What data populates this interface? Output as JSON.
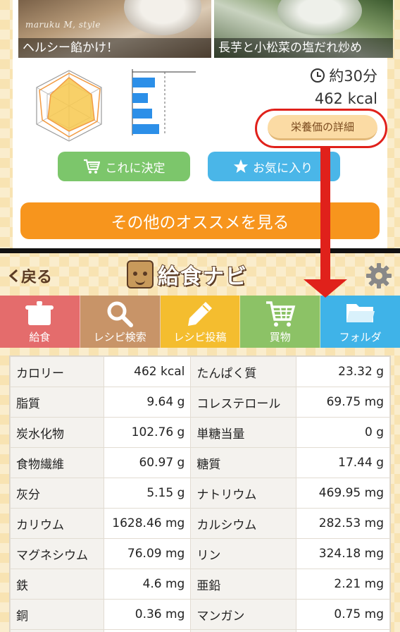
{
  "recipes": [
    {
      "name": "ヘルシー餡かけ！",
      "credit": "maruku M, style"
    },
    {
      "name": "長芋と小松菜の塩だれ炒め"
    }
  ],
  "summary": {
    "time": "約30分",
    "calories": "462 kcal"
  },
  "buttons": {
    "nutrition_detail": "栄養価の詳細",
    "decide": "これに決定",
    "favorite": "お気に入り",
    "more": "その他のオススメを見る"
  },
  "header": {
    "back": "戻る",
    "logo": "給食ナビ"
  },
  "tabs": [
    {
      "label": "給食",
      "color": "#e46c6c",
      "icon": "pot-icon"
    },
    {
      "label": "レシピ検索",
      "color": "#c89468",
      "icon": "magnifier-icon"
    },
    {
      "label": "レシピ投稿",
      "color": "#f4bd2f",
      "icon": "pencil-icon"
    },
    {
      "label": "買物",
      "color": "#8cc266",
      "icon": "cart-icon"
    },
    {
      "label": "フォルダ",
      "color": "#3fb3e8",
      "icon": "folder-icon"
    }
  ],
  "nutrition": [
    [
      "カロリー",
      "462 kcal",
      "たんぱく質",
      "23.32 g"
    ],
    [
      "脂質",
      "9.64 g",
      "コレステロール",
      "69.75 mg"
    ],
    [
      "炭水化物",
      "102.76 g",
      "単糖当量",
      "0 g"
    ],
    [
      "食物繊維",
      "60.97 g",
      "糖質",
      "17.44 g"
    ],
    [
      "灰分",
      "5.15 g",
      "ナトリウム",
      "469.95 mg"
    ],
    [
      "カリウム",
      "1628.46 mg",
      "カルシウム",
      "282.53 mg"
    ],
    [
      "マグネシウム",
      "76.09 mg",
      "リン",
      "324.18 mg"
    ],
    [
      "鉄",
      "4.6 mg",
      "亜鉛",
      "2.21 mg"
    ],
    [
      "銅",
      "0.36 mg",
      "マンガン",
      "0.75 mg"
    ],
    [
      "",
      "",
      "",
      ""
    ]
  ],
  "colors": {
    "highlight": "#e0211b",
    "more_button": "#f7951d",
    "decide_button": "#7cc66b",
    "favorite_button": "#4ab6e8",
    "detail_button": "#fbdba4"
  }
}
